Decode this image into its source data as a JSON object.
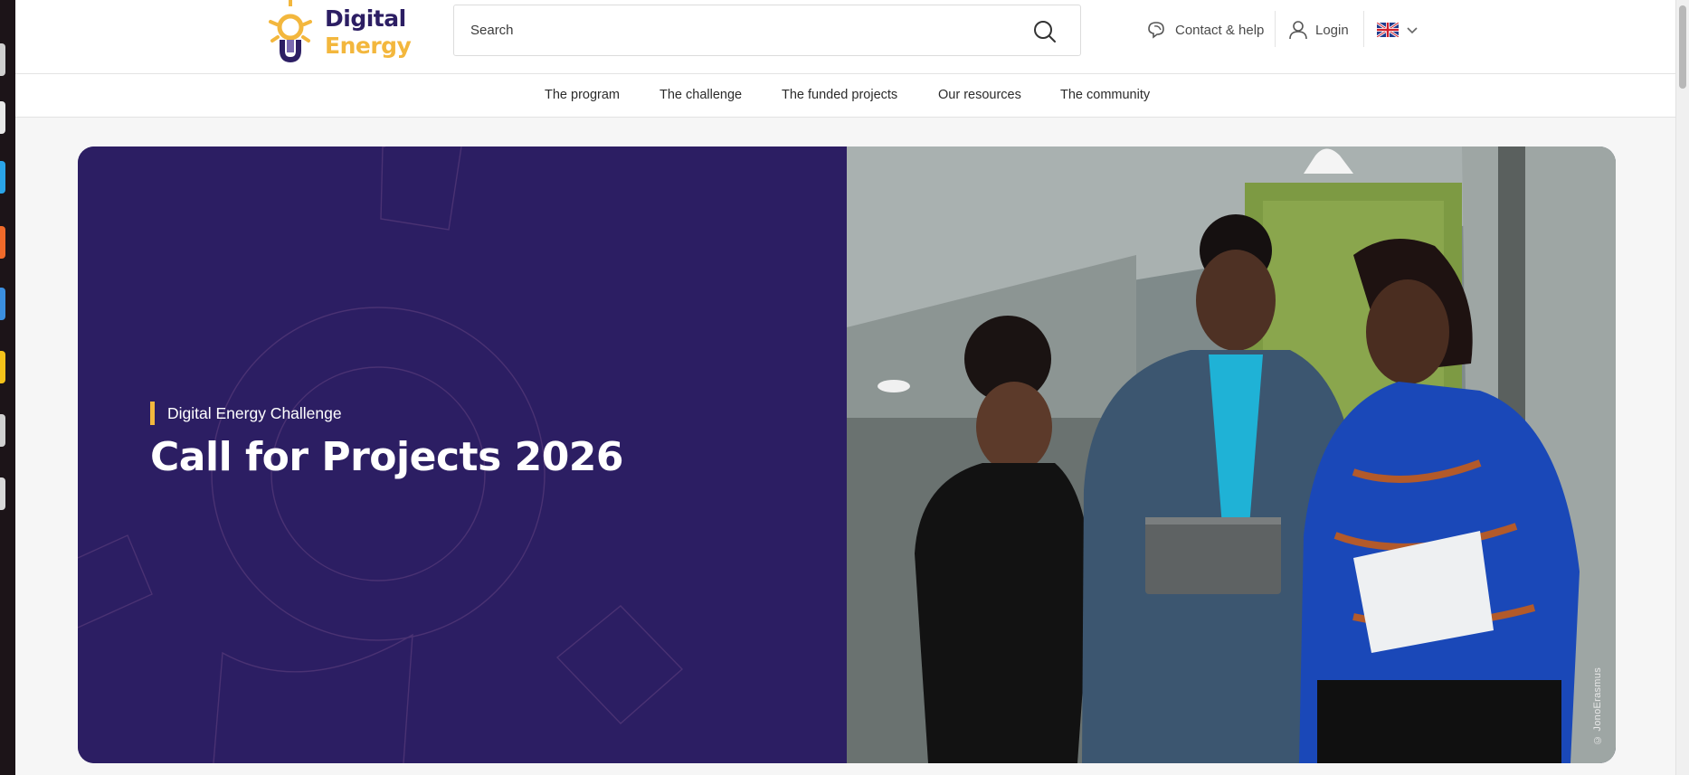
{
  "logo": {
    "line1": "Digital",
    "line2": "Energy",
    "icon": "lightbulb-logo-icon"
  },
  "search": {
    "placeholder": "Search",
    "value": "",
    "icon": "search-icon"
  },
  "header_links": {
    "contact": {
      "label": "Contact & help",
      "icon": "chat-bubble-icon"
    },
    "login": {
      "label": "Login",
      "icon": "user-icon"
    },
    "language": {
      "icon": "uk-flag-icon",
      "chevron": "chevron-down-icon"
    }
  },
  "nav": [
    {
      "label": "The program"
    },
    {
      "label": "The challenge"
    },
    {
      "label": "The funded projects"
    },
    {
      "label": "Our resources"
    },
    {
      "label": "The community"
    }
  ],
  "hero": {
    "eyebrow": "Digital Energy Challenge",
    "title": "Call for Projects 2026",
    "photo_credit": "© JonoErasmus"
  },
  "colors": {
    "brand_purple": "#2c1e63",
    "brand_yellow": "#f3b73d",
    "page_bg": "#f6f6f6"
  }
}
